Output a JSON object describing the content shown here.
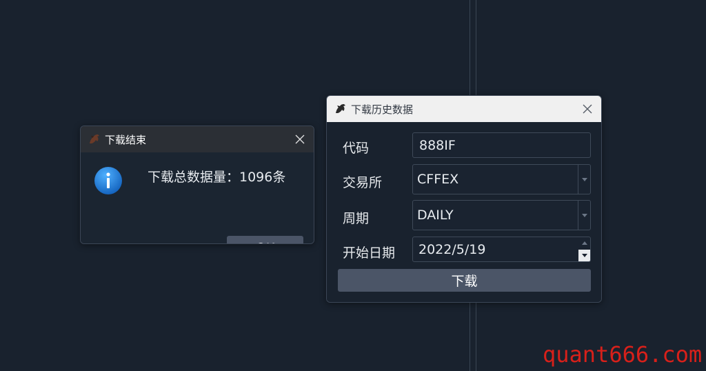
{
  "message_box": {
    "title": "下载结束",
    "icon": "info-icon",
    "message": "下载总数据量：1096条",
    "ok_label": "OK"
  },
  "download_dialog": {
    "title": "下载历史数据",
    "fields": {
      "symbol": {
        "label": "代码",
        "value": "888IF"
      },
      "exchange": {
        "label": "交易所",
        "value": "CFFEX"
      },
      "interval": {
        "label": "周期",
        "value": "DAILY"
      },
      "start_date": {
        "label": "开始日期",
        "value": "2022/5/19"
      }
    },
    "download_label": "下载"
  },
  "watermark": "quant666.com",
  "colors": {
    "background": "#19222e",
    "button": "#4b5567",
    "info_blue": "#1e88e5",
    "watermark_red": "#d8201a"
  }
}
